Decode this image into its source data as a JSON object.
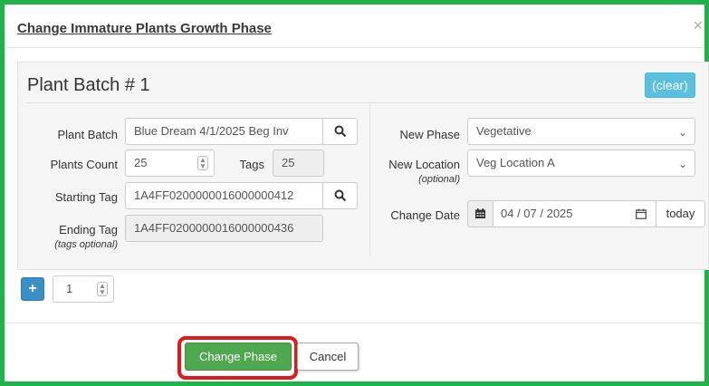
{
  "dialog": {
    "title": "Change Immature Plants Growth Phase",
    "close_icon": "×"
  },
  "batch": {
    "title": "Plant Batch # 1",
    "clear_label": "(clear)",
    "plant_batch_label": "Plant Batch",
    "plant_batch_value": "Blue Dream 4/1/2025 Beg Inv",
    "plants_count_label": "Plants Count",
    "plants_count_value": "25",
    "tags_label": "Tags",
    "tags_value": "25",
    "starting_tag_label": "Starting Tag",
    "starting_tag_value": "1A4FF0200000016000000412",
    "ending_tag_label": "Ending Tag",
    "ending_tag_sublabel": "(tags optional)",
    "ending_tag_value": "1A4FF0200000016000000436",
    "new_phase_label": "New Phase",
    "new_phase_value": "Vegetative",
    "new_location_label": "New Location",
    "new_location_sublabel": "(optional)",
    "new_location_value": "Veg Location A",
    "change_date_label": "Change Date",
    "change_date_value": "04 / 07 / 2025",
    "today_label": "today"
  },
  "add_batches": {
    "plus_label": "+",
    "count_value": "1"
  },
  "footer": {
    "primary_label": "Change Phase",
    "cancel_label": "Cancel"
  },
  "colors": {
    "frame_border": "#1fb34a",
    "clear_button": "#5bc0de",
    "plus_button": "#3a8fc4",
    "primary_button": "#4fa84f",
    "highlight": "#e0191c"
  },
  "icons": {
    "search": "search-icon",
    "calendar": "calendar-icon",
    "chevron": "chevron-down-icon",
    "spinner": "spinner-icon"
  }
}
